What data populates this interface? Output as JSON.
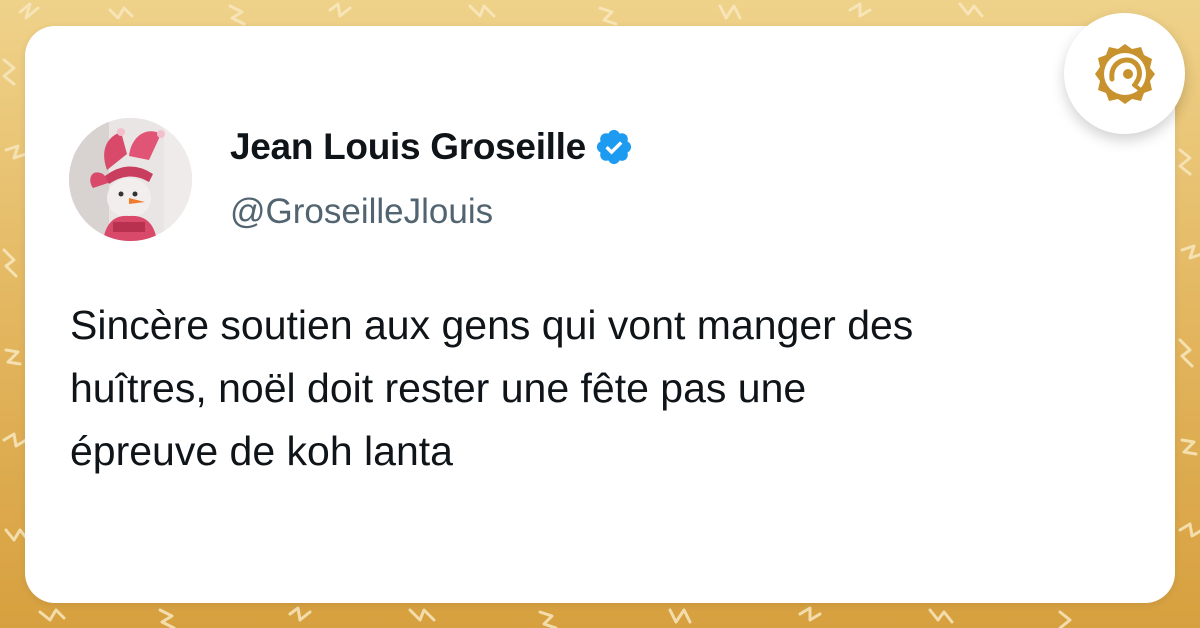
{
  "author": {
    "display_name": "Jean Louis Groseille",
    "handle": "@GroseilleJlouis",
    "verified": true
  },
  "tweet": {
    "lines": [
      "Sincère soutien aux gens qui vont manger des",
      "huîtres, noël doit rester une fête pas une",
      "épreuve de koh lanta"
    ]
  },
  "icons": {
    "verified": "verified-badge-icon",
    "brand": "brand-logo-icon"
  },
  "colors": {
    "verified_blue": "#1d9bf0",
    "brand_gold": "#c8932e",
    "text_primary": "#0f1419",
    "text_secondary": "#536471"
  }
}
